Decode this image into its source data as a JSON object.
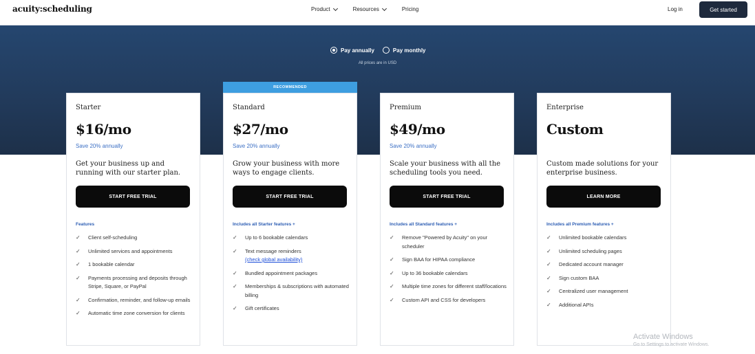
{
  "header": {
    "logo": "acuity:scheduling",
    "nav": [
      "Product",
      "Resources",
      "Pricing"
    ],
    "login": "Log in",
    "cta": "Get started"
  },
  "billing": {
    "annual": "Pay annually",
    "monthly": "Pay monthly",
    "note": "All prices are in USD",
    "selected": "annual"
  },
  "recommended_label": "RECOMMENDED",
  "plans": [
    {
      "tier": "Starter",
      "price": "$16/mo",
      "save": "Save 20% annually",
      "desc": "Get your business up and running with our starter plan.",
      "button": "START FREE TRIAL",
      "features_head": "Features",
      "features": [
        "Client self-scheduling",
        "Unlimited services and appointments",
        "1 bookable calendar",
        "Payments processing and deposits through Stripe, Square, or PayPal",
        "Confirmation, reminder, and follow-up emails",
        "Automatic time zone conversion for clients"
      ]
    },
    {
      "tier": "Standard",
      "price": "$27/mo",
      "save": "Save 20% annually",
      "desc": "Grow your business with more ways to engage clients.",
      "button": "START FREE TRIAL",
      "features_head": "Includes all Starter features +",
      "features": [
        "Up to 6 bookable calendars",
        "Text message reminders",
        "Bundled appointment packages",
        "Memberships & subscriptions with automated billing",
        "Gift certificates"
      ],
      "link": "(check global availability)"
    },
    {
      "tier": "Premium",
      "price": "$49/mo",
      "save": "Save 20% annually",
      "desc": "Scale your business with all the scheduling tools you need.",
      "button": "START FREE TRIAL",
      "features_head": "Includes all Standard features +",
      "features": [
        "Remove \"Powered by Acuity\" on your scheduler",
        "Sign BAA for HIPAA compliance",
        "Up to 36 bookable calendars",
        "Multiple time zones for different staff/locations",
        "Custom API and CSS for developers"
      ]
    },
    {
      "tier": "Enterprise",
      "price": "Custom",
      "save": "",
      "desc": "Custom made solutions for your enterprise business.",
      "button": "LEARN MORE",
      "features_head": "Includes all Premium features +",
      "features": [
        "Unlimited bookable calendars",
        "Unlimited scheduling pages",
        "Dedicated account manager",
        "Sign custom BAA",
        "Centralized user management",
        "Additional APIs"
      ]
    }
  ],
  "watermark": {
    "title": "Activate Windows",
    "sub": "Go to Settings to activate Windows."
  }
}
